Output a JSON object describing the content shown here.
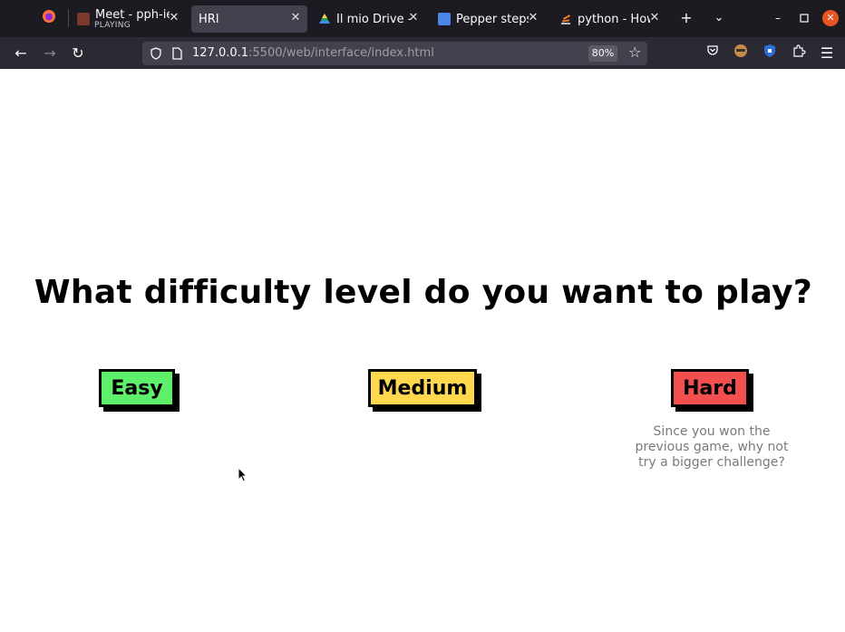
{
  "browser": {
    "tabs": [
      {
        "title": "Meet - pph-iet",
        "subtitle": "PLAYING",
        "active": false
      },
      {
        "title": "HRI",
        "active": true
      },
      {
        "title": "Il mio Drive - G",
        "active": false
      },
      {
        "title": "Pepper steps",
        "active": false
      },
      {
        "title": "python - How",
        "active": false
      }
    ],
    "url_host": "127.0.0.1",
    "url_path": ":5500/web/interface/index.html",
    "zoom": "80%"
  },
  "page": {
    "question": "What difficulty level do you want to play?",
    "buttons": {
      "easy": "Easy",
      "medium": "Medium",
      "hard": "Hard"
    },
    "hint": "Since you won the previous game, why not try a bigger challenge?"
  },
  "colors": {
    "easy": "#5ef06a",
    "medium": "#ffd84d",
    "hard": "#f44f4f"
  }
}
